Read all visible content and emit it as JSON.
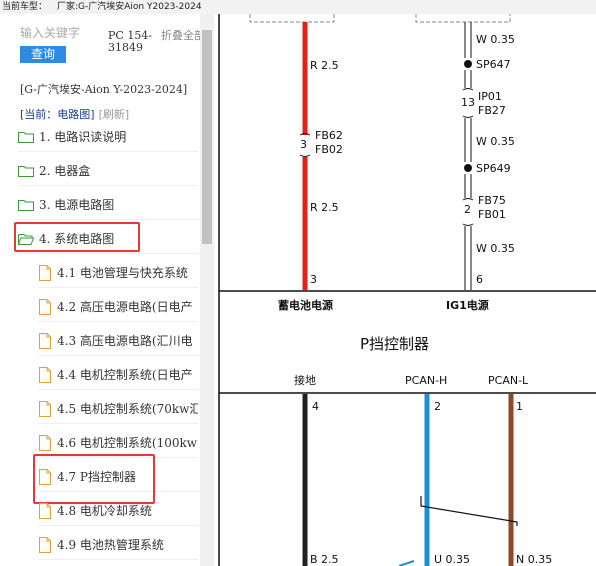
{
  "topbar": {
    "car_label": "当前车型：",
    "maker_label": "厂家:G-广汽埃安Aion Y2023-2024"
  },
  "sidebar": {
    "search_placeholder": "输入关键字",
    "query_label": "查询",
    "pc_code": "PC 154-31849",
    "collapse_all": "折叠全部",
    "path": "[G-广汽埃安-Aion Y-2023-2024]",
    "current_label": "[当前：电路图]",
    "refresh_label": "[刷新]",
    "items": [
      {
        "label": "1. 电路识读说明"
      },
      {
        "label": "2. 电器盒"
      },
      {
        "label": "3. 电源电路图"
      },
      {
        "label": "4. 系统电路图"
      }
    ],
    "children": [
      {
        "label": "4.1 电池管理与快充系统"
      },
      {
        "label": "4.2 高压电源电路(日电产"
      },
      {
        "label": "4.3 高压电源电路(汇川电"
      },
      {
        "label": "4.4 电机控制系统(日电产"
      },
      {
        "label": "4.5 电机控制系统(70kw汇"
      },
      {
        "label": "4.6 电机控制系统(100kw"
      },
      {
        "label": "4.7 P挡控制器"
      },
      {
        "label": "4.8 电机冷却系统"
      },
      {
        "label": "4.9 电池热管理系统"
      }
    ]
  },
  "diagram": {
    "colors": {
      "red": "#e32119",
      "blue": "#1e8fd5",
      "brown": "#8b4a2b",
      "black": "#222222"
    },
    "left_wire": {
      "seg1": "R 2.5",
      "conn_pin": "3",
      "conn_a": "FB62",
      "conn_b": "FB02",
      "seg2": "R 2.5",
      "end_pin": "3",
      "label": "蓄电池电源"
    },
    "right_wire": {
      "seg1": "W 0.35",
      "splice1": "SP647",
      "conn1_pin": "13",
      "conn1_a": "IP01",
      "conn1_b": "FB27",
      "seg2": "W 0.35",
      "splice2": "SP649",
      "conn2_pin": "2",
      "conn2_a": "FB75",
      "conn2_b": "FB01",
      "seg3": "W 0.35",
      "end_pin": "6",
      "label": "IG1电源"
    },
    "module_title": "P挡控制器",
    "pins": [
      {
        "name": "接地",
        "pin": "4",
        "wire": "B 2.5"
      },
      {
        "name": "PCAN-H",
        "pin": "2",
        "wire": "U 0.35"
      },
      {
        "name": "PCAN-L",
        "pin": "1",
        "wire": "N 0.35"
      }
    ]
  }
}
